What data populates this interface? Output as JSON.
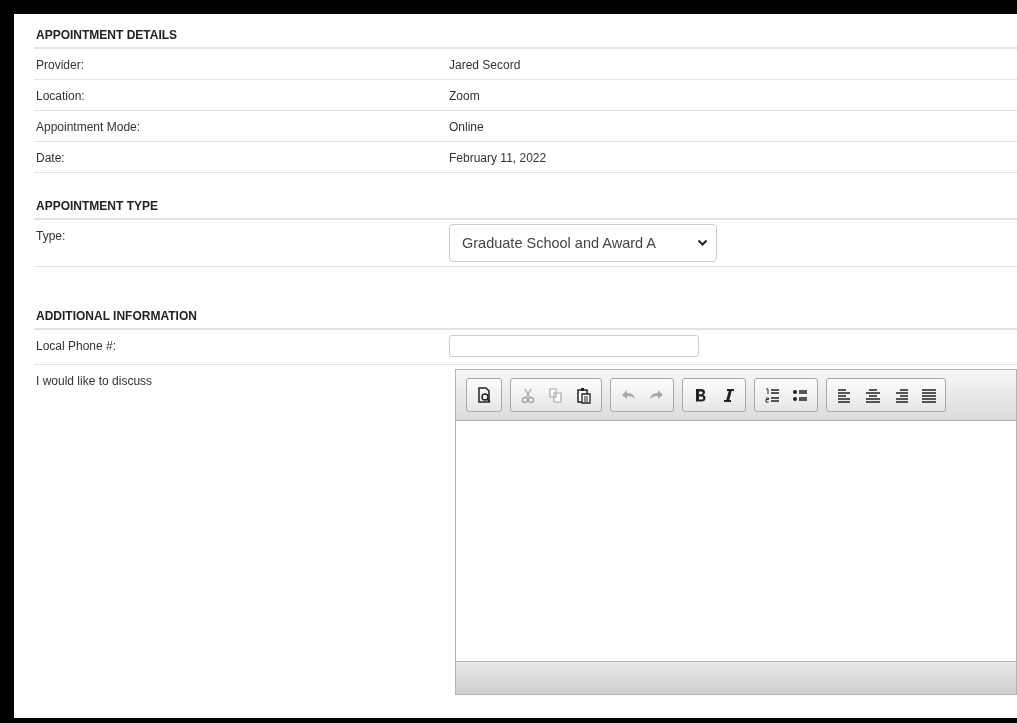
{
  "sections": [
    {
      "heading": "APPOINTMENT DETAILS",
      "rows": [
        {
          "kind": "text",
          "label": "Provider:",
          "value": "Jared Secord"
        },
        {
          "kind": "text",
          "label": "Location:",
          "value": "Zoom"
        },
        {
          "kind": "text",
          "label": "Appointment Mode:",
          "value": "Online"
        },
        {
          "kind": "text",
          "label": "Date:",
          "value": "February 11, 2022"
        }
      ]
    },
    {
      "heading": "APPOINTMENT TYPE",
      "rows": [
        {
          "kind": "select",
          "label": "Type:",
          "value": "Graduate School and Award A"
        }
      ]
    },
    {
      "heading": "ADDITIONAL INFORMATION",
      "rows": [
        {
          "kind": "input",
          "label": "Local Phone #:"
        },
        {
          "kind": "editor",
          "label": "I would like to discuss",
          "toolbar": [
            [
              {
                "kind": "preview",
                "disabled": false
              }
            ],
            [
              {
                "kind": "cut",
                "disabled": true
              },
              {
                "kind": "copy",
                "disabled": true
              },
              {
                "kind": "paste",
                "disabled": false
              }
            ],
            [
              {
                "kind": "undo",
                "disabled": true
              },
              {
                "kind": "redo",
                "disabled": true
              }
            ],
            [
              {
                "kind": "bold",
                "disabled": false
              },
              {
                "kind": "italic",
                "disabled": false
              }
            ],
            [
              {
                "kind": "numbered-list",
                "disabled": false
              },
              {
                "kind": "bulleted-list",
                "disabled": false
              }
            ],
            [
              {
                "kind": "align-left",
                "disabled": false
              },
              {
                "kind": "align-center",
                "disabled": false
              },
              {
                "kind": "align-right",
                "disabled": false
              },
              {
                "kind": "justify",
                "disabled": false
              }
            ]
          ]
        }
      ]
    }
  ]
}
